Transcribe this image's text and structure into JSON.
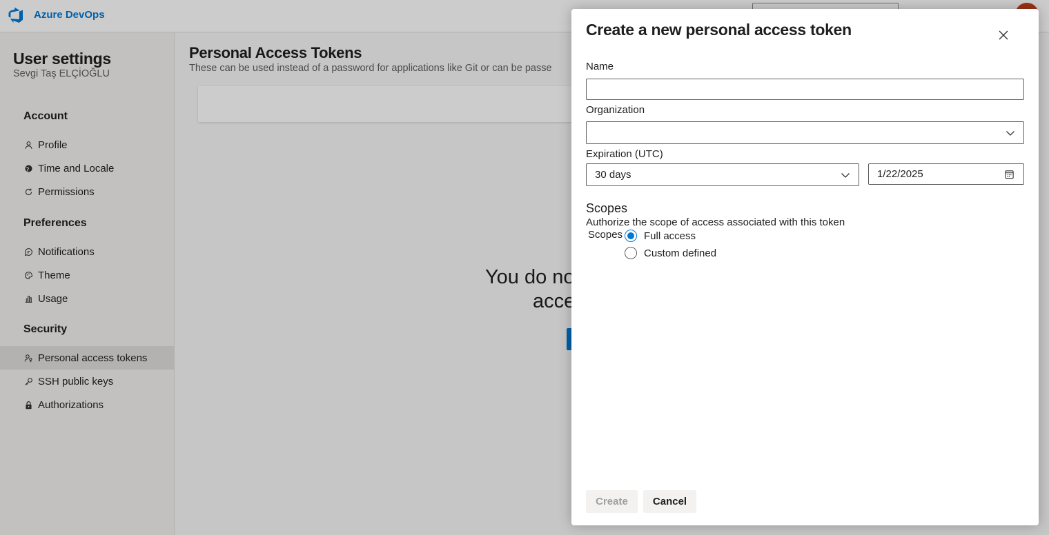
{
  "app": {
    "name": "Azure DevOps",
    "brand_color": "#0078d4"
  },
  "sidebar": {
    "title": "User settings",
    "user_name": "Sevgi Taş ELÇİOĞLU",
    "groups": [
      {
        "label": "Account",
        "items": [
          {
            "label": "Profile",
            "icon": "profile-icon"
          },
          {
            "label": "Time and Locale",
            "icon": "globe-icon"
          },
          {
            "label": "Permissions",
            "icon": "refresh-icon"
          }
        ]
      },
      {
        "label": "Preferences",
        "items": [
          {
            "label": "Notifications",
            "icon": "chat-icon"
          },
          {
            "label": "Theme",
            "icon": "palette-icon"
          },
          {
            "label": "Usage",
            "icon": "bar-chart-icon"
          }
        ]
      },
      {
        "label": "Security",
        "items": [
          {
            "label": "Personal access tokens",
            "icon": "person-key-icon",
            "active": true
          },
          {
            "label": "SSH public keys",
            "icon": "key-icon"
          },
          {
            "label": "Authorizations",
            "icon": "lock-icon"
          }
        ]
      }
    ]
  },
  "main": {
    "title": "Personal Access Tokens",
    "subtitle": "These can be used instead of a password for applications like Git or can be passe",
    "empty_line1": "You do no",
    "empty_line2": "acce"
  },
  "dialog": {
    "title": "Create a new personal access token",
    "close_icon": "close-icon",
    "name_label": "Name",
    "name_value": "",
    "organization_label": "Organization",
    "organization_value": "",
    "expiration_label": "Expiration (UTC)",
    "expiration_value": "30 days",
    "expiration_date": "1/22/2025",
    "scopes_heading": "Scopes",
    "scopes_description": "Authorize the scope of access associated with this token",
    "scopes_label": "Scopes",
    "scope_options": [
      {
        "label": "Full access",
        "selected": true
      },
      {
        "label": "Custom defined",
        "selected": false
      }
    ],
    "create_label": "Create",
    "cancel_label": "Cancel"
  }
}
